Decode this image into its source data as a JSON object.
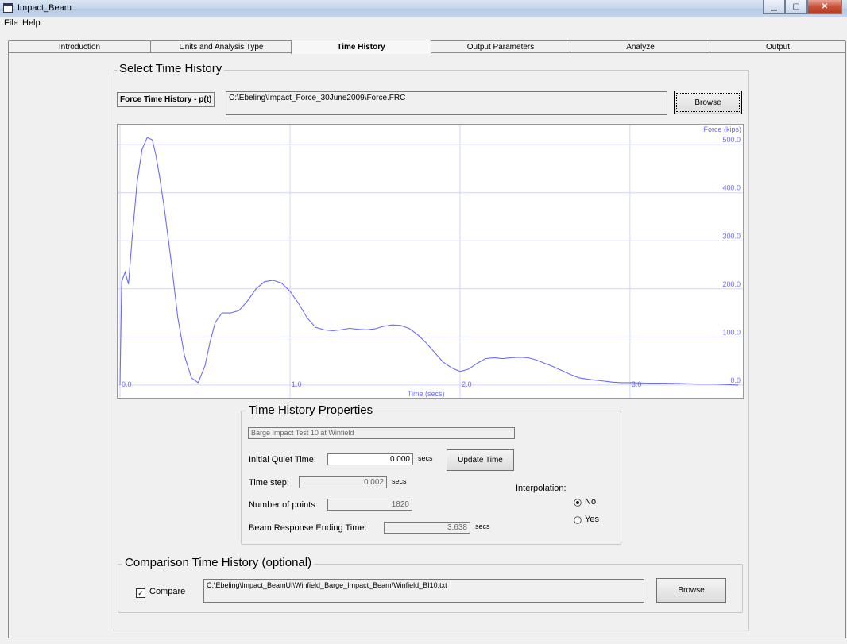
{
  "window": {
    "title": "Impact_Beam"
  },
  "menu": [
    "File",
    "Help"
  ],
  "tabs": [
    "Introduction",
    "Units and Analysis Type",
    "Time History",
    "Output Parameters",
    "Analyze",
    "Output"
  ],
  "active_tab": "Time History",
  "select": {
    "legend": "Select Time History",
    "force_label": "Force Time History - p(t)",
    "force_path": "C:\\Ebeling\\Impact_Force_30June2009\\Force.FRC",
    "browse": "Browse"
  },
  "chart_data": {
    "type": "line",
    "xlabel": "Time (secs)",
    "ylabel": "Force (kips)",
    "xlim": [
      0,
      3.65
    ],
    "ylim": [
      -20,
      535
    ],
    "x_ticks": [
      "0.0",
      "1.0",
      "2.0",
      "3.0"
    ],
    "y_ticks": [
      "0.0",
      "100.0",
      "200.0",
      "300.0",
      "400.0",
      "500.0"
    ],
    "x_tick_values": [
      0,
      1,
      2,
      3
    ],
    "y_tick_values": [
      0,
      100,
      200,
      300,
      400,
      500
    ],
    "color": "#6b6bff",
    "grid_color": "#d4d4ff",
    "series": [
      {
        "x": [
          0,
          0.01,
          0.03,
          0.05,
          0.07,
          0.1,
          0.13,
          0.16,
          0.19,
          0.21,
          0.23,
          0.26,
          0.3,
          0.34,
          0.38,
          0.42,
          0.46,
          0.5,
          0.53,
          0.56,
          0.6,
          0.65,
          0.7,
          0.75,
          0.8,
          0.85,
          0.9,
          0.95,
          1.0,
          1.05,
          1.1,
          1.15,
          1.2,
          1.25,
          1.3,
          1.35,
          1.4,
          1.45,
          1.5,
          1.55,
          1.6,
          1.65,
          1.7,
          1.75,
          1.8,
          1.85,
          1.9,
          1.95,
          2.0,
          2.05,
          2.1,
          2.15,
          2.2,
          2.25,
          2.3,
          2.35,
          2.4,
          2.45,
          2.5,
          2.55,
          2.6,
          2.65,
          2.7,
          2.75,
          2.8,
          2.85,
          2.9,
          2.95,
          3.0,
          3.1,
          3.2,
          3.3,
          3.4,
          3.5,
          3.638
        ],
        "y": [
          0,
          215,
          235,
          210,
          300,
          420,
          490,
          515,
          510,
          480,
          440,
          370,
          260,
          140,
          60,
          15,
          5,
          40,
          90,
          130,
          150,
          150,
          155,
          175,
          200,
          215,
          218,
          212,
          195,
          170,
          140,
          120,
          115,
          113,
          115,
          118,
          116,
          115,
          117,
          122,
          125,
          124,
          118,
          105,
          88,
          68,
          48,
          36,
          28,
          33,
          45,
          55,
          57,
          55,
          57,
          58,
          57,
          52,
          45,
          38,
          30,
          22,
          15,
          12,
          10,
          8,
          6,
          5,
          5,
          4,
          4,
          3,
          2,
          2,
          0
        ]
      }
    ]
  },
  "props": {
    "legend": "Time History Properties",
    "description": "Barge Impact Test 10 at Winfield",
    "quiet_label": "Initial Quiet Time:",
    "quiet_value": "0.000",
    "secs": "secs",
    "update": "Update Time",
    "step_label": "Time step:",
    "step_value": "0.002",
    "npts_label": "Number of points:",
    "npts_value": "1820",
    "end_label": "Beam Response Ending Time:",
    "end_value": "3.638",
    "interp_label": "Interpolation:",
    "interp_no": "No",
    "interp_yes": "Yes",
    "interp_selected": "No"
  },
  "compare": {
    "legend": "Comparison Time History (optional)",
    "check_label": "Compare",
    "checked": true,
    "path": "C:\\Ebeling\\Impact_BeamUI\\Winfield_Barge_Impact_Beam\\Winfield_BI10.txt",
    "browse": "Browse"
  }
}
